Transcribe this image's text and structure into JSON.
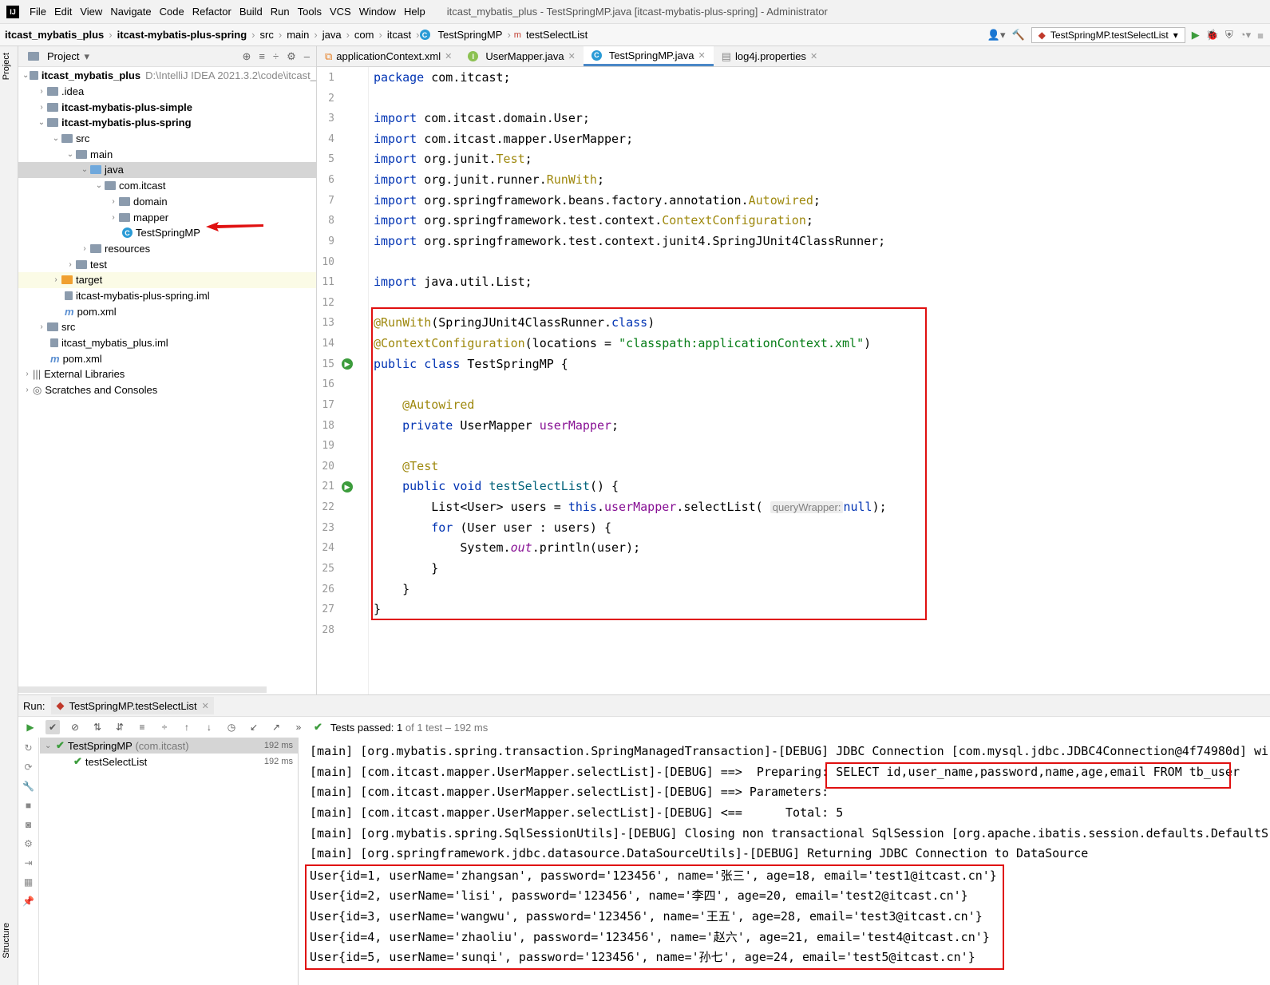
{
  "menubar": {
    "items": [
      "File",
      "Edit",
      "View",
      "Navigate",
      "Code",
      "Refactor",
      "Build",
      "Run",
      "Tools",
      "VCS",
      "Window",
      "Help"
    ],
    "title": "itcast_mybatis_plus - TestSpringMP.java [itcast-mybatis-plus-spring] - Administrator"
  },
  "nav": {
    "crumbs": [
      "itcast_mybatis_plus",
      "itcast-mybatis-plus-spring",
      "src",
      "main",
      "java",
      "com",
      "itcast",
      "TestSpringMP",
      "testSelectList"
    ],
    "run_config": "TestSpringMP.testSelectList"
  },
  "side": {
    "project_tab": "Project",
    "structure_tab": "Structure"
  },
  "project": {
    "header": "Project",
    "tree": [
      {
        "label": "itcast_mybatis_plus",
        "path": "D:\\IntelliJ IDEA 2021.3.2\\code\\itcast_",
        "bold": true
      },
      {
        "label": ".idea"
      },
      {
        "label": "itcast-mybatis-plus-simple",
        "bold": true
      },
      {
        "label": "itcast-mybatis-plus-spring",
        "bold": true
      },
      {
        "label": "src"
      },
      {
        "label": "main"
      },
      {
        "label": "java"
      },
      {
        "label": "com.itcast"
      },
      {
        "label": "domain"
      },
      {
        "label": "mapper"
      },
      {
        "label": "TestSpringMP"
      },
      {
        "label": "resources"
      },
      {
        "label": "test"
      },
      {
        "label": "target"
      },
      {
        "label": "itcast-mybatis-plus-spring.iml"
      },
      {
        "label": "pom.xml"
      },
      {
        "label": "src"
      },
      {
        "label": "itcast_mybatis_plus.iml"
      },
      {
        "label": "pom.xml"
      },
      {
        "label": "External Libraries"
      },
      {
        "label": "Scratches and Consoles"
      }
    ]
  },
  "editor": {
    "tabs": [
      "applicationContext.xml",
      "UserMapper.java",
      "TestSpringMP.java",
      "log4j.properties"
    ],
    "line_numbers": [
      "1",
      "2",
      "3",
      "4",
      "5",
      "6",
      "7",
      "8",
      "9",
      "10",
      "11",
      "12",
      "13",
      "14",
      "15",
      "16",
      "17",
      "18",
      "19",
      "20",
      "21",
      "22",
      "23",
      "24",
      "25",
      "26",
      "27",
      "28"
    ],
    "hint": "queryWrapper:"
  },
  "run": {
    "label": "Run:",
    "tab": "TestSpringMP.testSelectList",
    "status_prefix": "Tests passed:",
    "status_count": "1",
    "status_suffix": "of 1 test – 192 ms",
    "tests": [
      {
        "name": "TestSpringMP",
        "pkg": "(com.itcast)",
        "time": "192 ms"
      },
      {
        "name": "testSelectList",
        "time": "192 ms"
      }
    ],
    "console": [
      "[main] [org.mybatis.spring.transaction.SpringManagedTransaction]-[DEBUG] JDBC Connection [com.mysql.jdbc.JDBC4Connection@4f74980d] wi",
      "[main] [com.itcast.mapper.UserMapper.selectList]-[DEBUG] ==>  Preparing: SELECT id,user_name,password,name,age,email FROM tb_user",
      "[main] [com.itcast.mapper.UserMapper.selectList]-[DEBUG] ==> Parameters: ",
      "[main] [com.itcast.mapper.UserMapper.selectList]-[DEBUG] <==      Total: 5",
      "[main] [org.mybatis.spring.SqlSessionUtils]-[DEBUG] Closing non transactional SqlSession [org.apache.ibatis.session.defaults.DefaultS",
      "[main] [org.springframework.jdbc.datasource.DataSourceUtils]-[DEBUG] Returning JDBC Connection to DataSource",
      "User{id=1, userName='zhangsan', password='123456', name='张三', age=18, email='test1@itcast.cn'}",
      "User{id=2, userName='lisi', password='123456', name='李四', age=20, email='test2@itcast.cn'}",
      "User{id=3, userName='wangwu', password='123456', name='王五', age=28, email='test3@itcast.cn'}",
      "User{id=4, userName='zhaoliu', password='123456', name='赵六', age=21, email='test4@itcast.cn'}",
      "User{id=5, userName='sunqi', password='123456', name='孙七', age=24, email='test5@itcast.cn'}"
    ]
  },
  "colors": {
    "keyword": "#0033b3",
    "annotation": "#9e880d",
    "string": "#067d17",
    "field": "#871094",
    "highlight": "#e01010"
  }
}
